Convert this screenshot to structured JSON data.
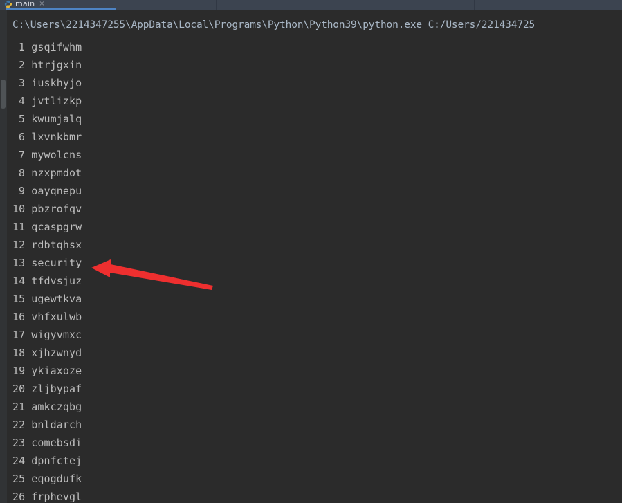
{
  "window": {
    "app": "python-console-output",
    "background_color": "#2b2b2b",
    "text_color": "#bbbbbb"
  },
  "tabbar": {
    "background_color": "#3c4450",
    "active_tab": {
      "label": "main",
      "icon": "python-file-icon",
      "close_glyph": "×",
      "underline_color": "#4e84c4"
    }
  },
  "console": {
    "command_line": "C:\\Users\\2214347255\\AppData\\Local\\Programs\\Python\\Python39\\python.exe C:/Users/221434725",
    "rows": [
      {
        "index": "1",
        "value": "gsqifwhm"
      },
      {
        "index": "2",
        "value": "htrjgxin"
      },
      {
        "index": "3",
        "value": "iuskhyjo"
      },
      {
        "index": "4",
        "value": "jvtlizkp"
      },
      {
        "index": "5",
        "value": "kwumjalq"
      },
      {
        "index": "6",
        "value": "lxvnkbmr"
      },
      {
        "index": "7",
        "value": "mywolcns"
      },
      {
        "index": "8",
        "value": "nzxpmdot"
      },
      {
        "index": "9",
        "value": "oayqnepu"
      },
      {
        "index": "10",
        "value": "pbzrofqv"
      },
      {
        "index": "11",
        "value": "qcaspgrw"
      },
      {
        "index": "12",
        "value": "rdbtqhsx"
      },
      {
        "index": "13",
        "value": "security"
      },
      {
        "index": "14",
        "value": "tfdvsjuz"
      },
      {
        "index": "15",
        "value": "ugewtkva"
      },
      {
        "index": "16",
        "value": "vhfxulwb"
      },
      {
        "index": "17",
        "value": "wigyvmxc"
      },
      {
        "index": "18",
        "value": "xjhzwnyd"
      },
      {
        "index": "19",
        "value": "ykiaxoze"
      },
      {
        "index": "20",
        "value": "zljbypaf"
      },
      {
        "index": "21",
        "value": "amkczqbg"
      },
      {
        "index": "22",
        "value": "bnldarch"
      },
      {
        "index": "23",
        "value": "comebsdi"
      },
      {
        "index": "24",
        "value": "dpnfctej"
      },
      {
        "index": "25",
        "value": "eqogdufk"
      },
      {
        "index": "26",
        "value": "frphevgl"
      }
    ]
  },
  "annotation": {
    "type": "arrow",
    "color": "#ee2f2f",
    "points_to_row_index": "13",
    "points_to_value": "security",
    "direction": "left"
  }
}
